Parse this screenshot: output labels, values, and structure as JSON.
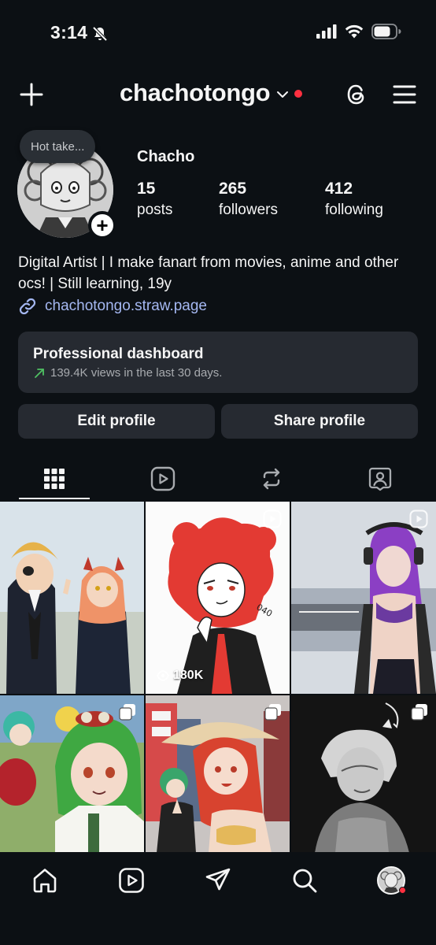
{
  "status_bar": {
    "time": "3:14"
  },
  "header": {
    "username": "chachotongo",
    "notification_color": "#ff3040"
  },
  "profile": {
    "note": "Hot take...",
    "display_name": "Chacho",
    "stats": [
      {
        "value": "15",
        "label": "posts"
      },
      {
        "value": "265",
        "label": "followers"
      },
      {
        "value": "412",
        "label": "following"
      }
    ],
    "bio": "Digital Artist | I make fanart from movies, anime and other ocs! | Still learning, 19y",
    "link": "chachotongo.straw.page",
    "link_color": "#a5b8f2"
  },
  "dashboard": {
    "title": "Professional dashboard",
    "subtitle": "139.4K views in the last 30 days.",
    "trend_color": "#4fc163"
  },
  "buttons": {
    "edit": "Edit profile",
    "share": "Share profile"
  },
  "tabs": [
    {
      "icon": "grid-icon",
      "active": true
    },
    {
      "icon": "reels-icon",
      "active": false
    },
    {
      "icon": "reposts-icon",
      "active": false
    },
    {
      "icon": "tagged-icon",
      "active": false
    }
  ],
  "posts": [
    {
      "badge": "",
      "views": ""
    },
    {
      "badge": "reel-icon",
      "views": "180K"
    },
    {
      "badge": "reel-icon",
      "views": ""
    },
    {
      "badge": "carousel-icon",
      "views": ""
    },
    {
      "badge": "carousel-icon",
      "views": ""
    },
    {
      "badge": "carousel-icon",
      "views": ""
    }
  ],
  "bottom_nav": [
    "home-icon",
    "reels-icon",
    "direct-icon",
    "search-icon",
    "profile-avatar"
  ]
}
